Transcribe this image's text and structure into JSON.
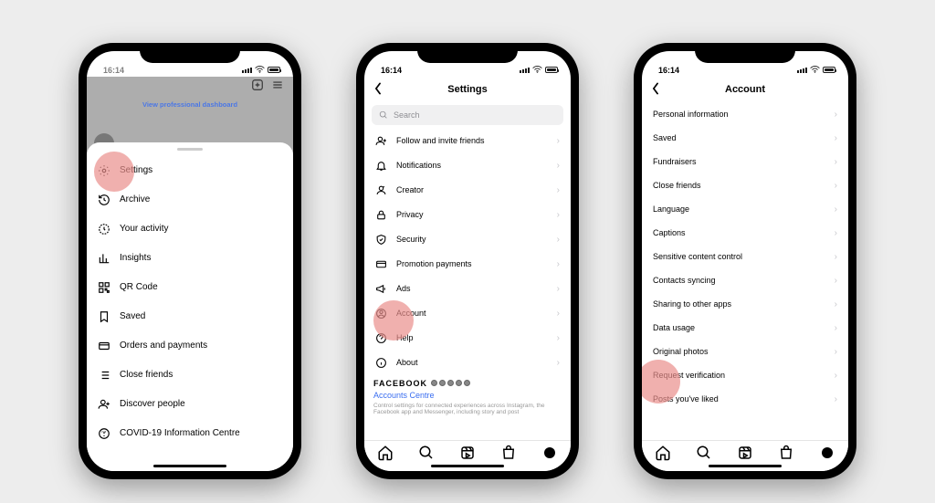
{
  "status": {
    "time": "16:14"
  },
  "highlight_color": "#ea8e8b",
  "phone1": {
    "bg_link": "View professional dashboard",
    "menu": [
      {
        "icon": "gear",
        "label": "Settings",
        "highlight": true
      },
      {
        "icon": "history",
        "label": "Archive"
      },
      {
        "icon": "clock",
        "label": "Your activity"
      },
      {
        "icon": "chart",
        "label": "Insights"
      },
      {
        "icon": "qr",
        "label": "QR Code"
      },
      {
        "icon": "bookmark",
        "label": "Saved"
      },
      {
        "icon": "card",
        "label": "Orders and payments"
      },
      {
        "icon": "list",
        "label": "Close friends"
      },
      {
        "icon": "person-plus",
        "label": "Discover people"
      },
      {
        "icon": "info",
        "label": "COVID-19 Information Centre"
      }
    ]
  },
  "phone2": {
    "title": "Settings",
    "search_placeholder": "Search",
    "items": [
      {
        "icon": "person-plus",
        "label": "Follow and invite friends"
      },
      {
        "icon": "bell",
        "label": "Notifications"
      },
      {
        "icon": "creator",
        "label": "Creator"
      },
      {
        "icon": "lock",
        "label": "Privacy"
      },
      {
        "icon": "shield",
        "label": "Security"
      },
      {
        "icon": "card",
        "label": "Promotion payments"
      },
      {
        "icon": "megaphone",
        "label": "Ads"
      },
      {
        "icon": "account",
        "label": "Account",
        "highlight": true
      },
      {
        "icon": "help",
        "label": "Help"
      },
      {
        "icon": "info",
        "label": "About"
      }
    ],
    "facebook": {
      "brand": "FACEBOOK",
      "link": "Accounts Centre",
      "desc": "Control settings for connected experiences across Instagram, the Facebook app and Messenger, including story and post"
    }
  },
  "phone3": {
    "title": "Account",
    "items": [
      {
        "label": "Personal information"
      },
      {
        "label": "Saved"
      },
      {
        "label": "Fundraisers"
      },
      {
        "label": "Close friends"
      },
      {
        "label": "Language"
      },
      {
        "label": "Captions"
      },
      {
        "label": "Sensitive content control"
      },
      {
        "label": "Contacts syncing"
      },
      {
        "label": "Sharing to other apps"
      },
      {
        "label": "Data usage"
      },
      {
        "label": "Original photos"
      },
      {
        "label": "Request verification",
        "highlight": true
      },
      {
        "label": "Posts you've liked"
      }
    ]
  },
  "tabs": [
    "home",
    "search",
    "reels",
    "shop",
    "profile"
  ]
}
